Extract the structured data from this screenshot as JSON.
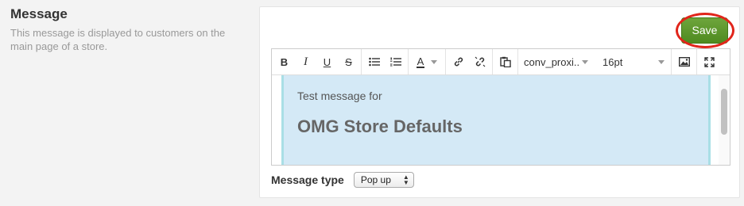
{
  "section": {
    "title": "Message",
    "description": "This message is displayed to customers on the main page of a store."
  },
  "actions": {
    "save_label": "Save"
  },
  "toolbar": {
    "bold": "B",
    "italic": "I",
    "underline": "U",
    "strikethrough": "S",
    "text_color": "A",
    "font_family": "conv_proxi..",
    "font_size": "16pt"
  },
  "editor": {
    "line1": "Test message for",
    "heading": "OMG Store Defaults"
  },
  "message_type": {
    "label": "Message type",
    "selected": "Pop up"
  },
  "colors": {
    "save_button": "#5b9a2b",
    "highlight_ring": "#e1251b",
    "content_bg": "#d4e9f6"
  }
}
